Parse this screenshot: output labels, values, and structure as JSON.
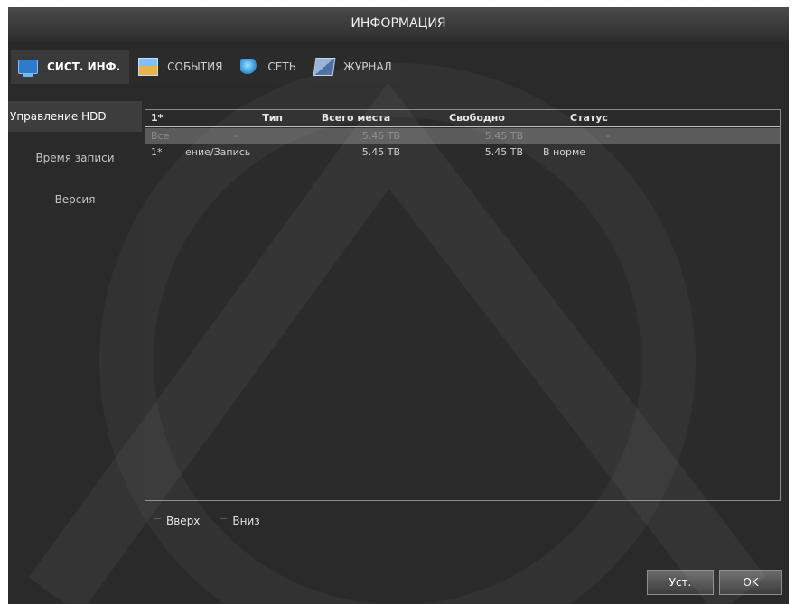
{
  "window": {
    "title": "ИНФОРМАЦИЯ"
  },
  "tabs": [
    {
      "label": "СИСТ. ИНФ.",
      "icon": "monitor-icon",
      "active": true
    },
    {
      "label": "СОБЫТИЯ",
      "icon": "event-icon",
      "active": false
    },
    {
      "label": "СЕТЬ",
      "icon": "network-icon",
      "active": false
    },
    {
      "label": "ЖУРНАЛ",
      "icon": "log-icon",
      "active": false
    }
  ],
  "sidebar": {
    "items": [
      {
        "label": "Управление HDD",
        "active": true
      },
      {
        "label": "Время записи",
        "active": false
      },
      {
        "label": "Версия",
        "active": false
      }
    ]
  },
  "table": {
    "headers": [
      "1*",
      "Тип",
      "Всего места",
      "Свободно",
      "Статус"
    ],
    "rows": [
      {
        "id": "Все",
        "type": "-",
        "total": "5.45 TB",
        "free": "5.45 TB",
        "status": "-"
      },
      {
        "id": "1*",
        "type": "ение/Запись",
        "total": "5.45 TB",
        "free": "5.45 TB",
        "status": "В норме"
      }
    ]
  },
  "pager": {
    "up_label": "Вверх",
    "down_label": "Вниз"
  },
  "buttons": {
    "apply_label": "Уст.",
    "ok_label": "OK"
  },
  "colors": {
    "panel_bg": "#2a2a2a",
    "title_bg": "#3a3a3a",
    "selected_row": "#5b5b5b",
    "text": "#e6e6e6"
  }
}
